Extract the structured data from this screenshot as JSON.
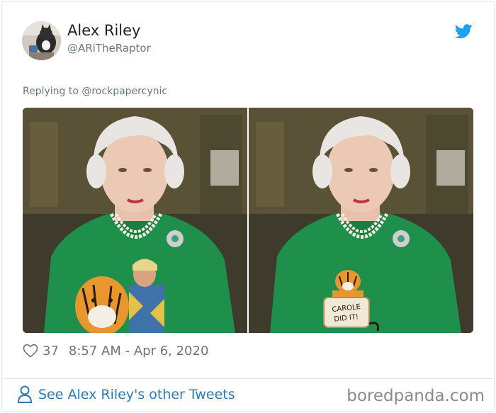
{
  "tweet": {
    "author_name": "Alex Riley",
    "author_handle": "@ARiTheRaptor",
    "replying_to_prefix": "Replying to ",
    "replying_to_handle": "@rockpapercynic",
    "like_count": "37",
    "timestamp": "8:57 AM - Apr 6, 2020"
  },
  "media": {
    "left_image": "photo-queen-with-tiger-king-cutout",
    "right_image": "photo-queen-with-tiger-sign",
    "sign_text_line1": "CAROLE",
    "sign_text_line2": "DID IT!"
  },
  "footer": {
    "see_more_label": "See Alex Riley's other Tweets",
    "watermark": "boredpanda.com"
  },
  "colors": {
    "twitter_blue": "#1da1f2",
    "link_blue": "#2b7bb9",
    "muted_text": "#697882",
    "green_dress": "#1f8f4c"
  },
  "icons": [
    "twitter-bird-icon",
    "heart-icon",
    "person-icon"
  ]
}
